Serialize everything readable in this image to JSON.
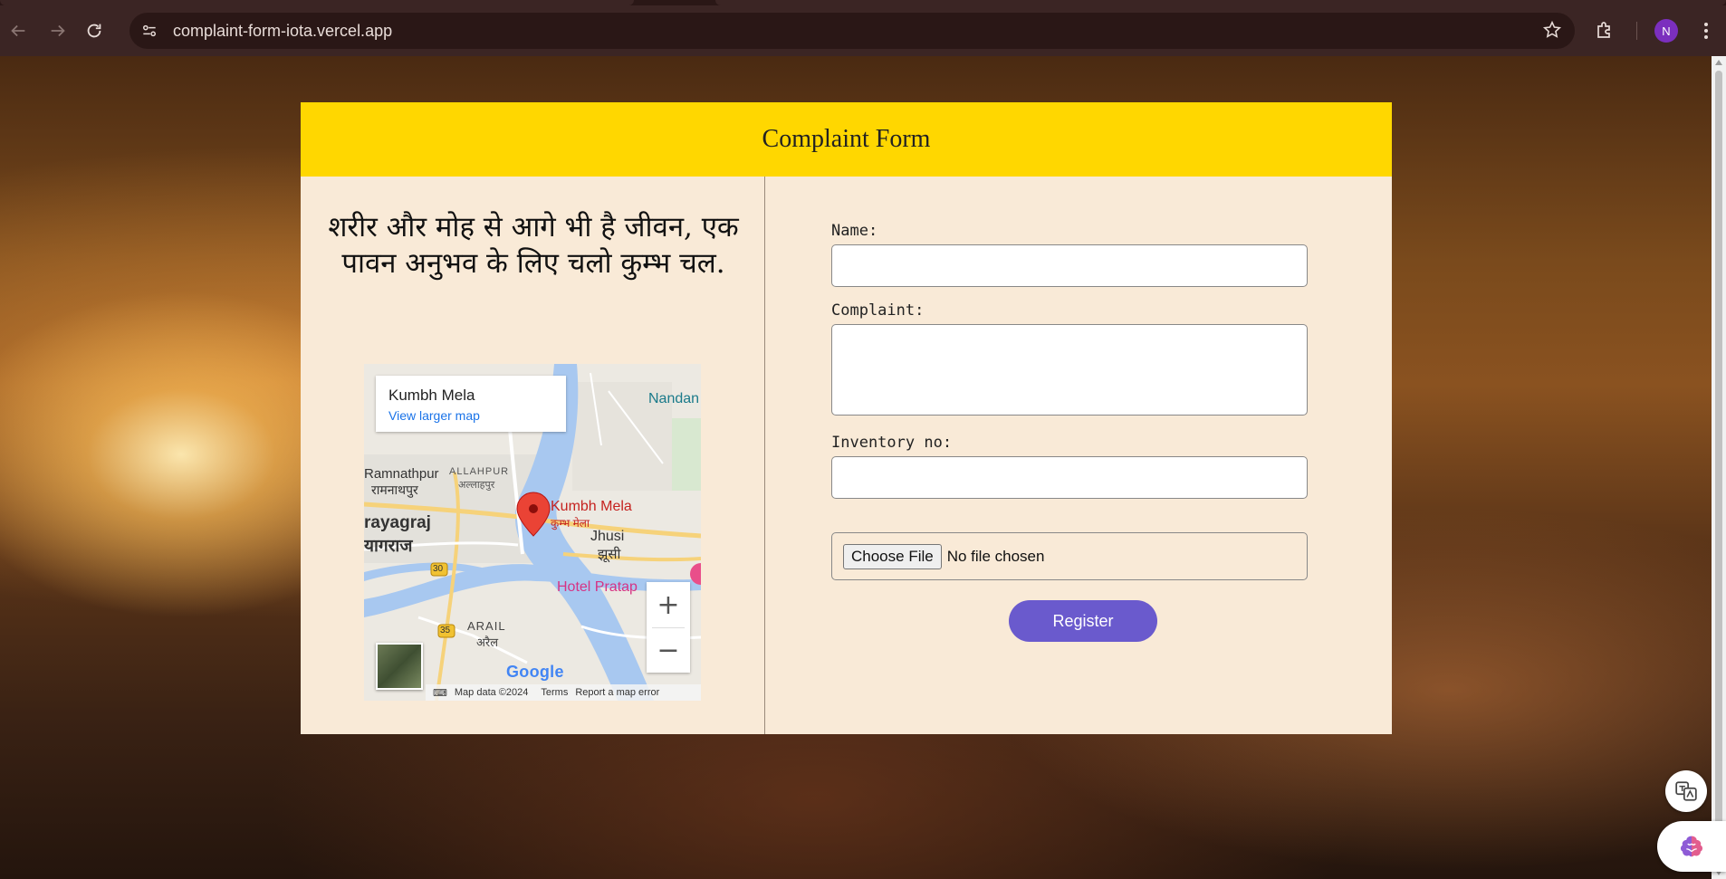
{
  "browser": {
    "url": "complaint-form-iota.vercel.app",
    "profile_initial": "N"
  },
  "card": {
    "title": "Complaint Form",
    "quote": "शरीर और मोह से आगे भी है जीवन, एक पावन अनुभव के लिए चलो कुम्भ चल."
  },
  "map": {
    "place_name": "Kumbh Mela",
    "view_larger": "View larger map",
    "labels": {
      "nandan_water": "Nandan Water",
      "allahpur": "ALLAHPUR",
      "allahpur_hi": "अल्लाहपुर",
      "ramnathpur": "Ramnathpur",
      "ramnathpur_hi": "रामनाथपुर",
      "prayagraj": "rayagraj",
      "prayagraj_hi": "यागराज",
      "kumbh_mela": "Kumbh Mela",
      "kumbh_mela_hi": "कुम्भ मेला",
      "jhusi": "Jhusi",
      "jhusi_hi": "झूसी",
      "hotel_pratap": "Hotel Pratap",
      "arail": "ARAIL",
      "arail_hi": "अरैल",
      "road_30": "30",
      "road_35": "35"
    },
    "google": "Google",
    "map_data": "Map data ©2024",
    "terms": "Terms",
    "report": "Report a map error",
    "zoom_in": "+",
    "zoom_out": "−"
  },
  "form": {
    "name_label": "Name:",
    "name_value": "",
    "complaint_label": "Complaint:",
    "complaint_value": "",
    "inventory_label": "Inventory no:",
    "inventory_value": "",
    "file_button": "Choose File",
    "file_status": "No file chosen",
    "register_button": "Register"
  },
  "icons": {
    "back": "arrow-left-icon",
    "forward": "arrow-right-icon",
    "reload": "reload-icon",
    "site_info": "site-settings-icon",
    "bookmark": "star-icon",
    "extensions": "puzzle-icon",
    "menu": "kebab-menu-icon"
  }
}
